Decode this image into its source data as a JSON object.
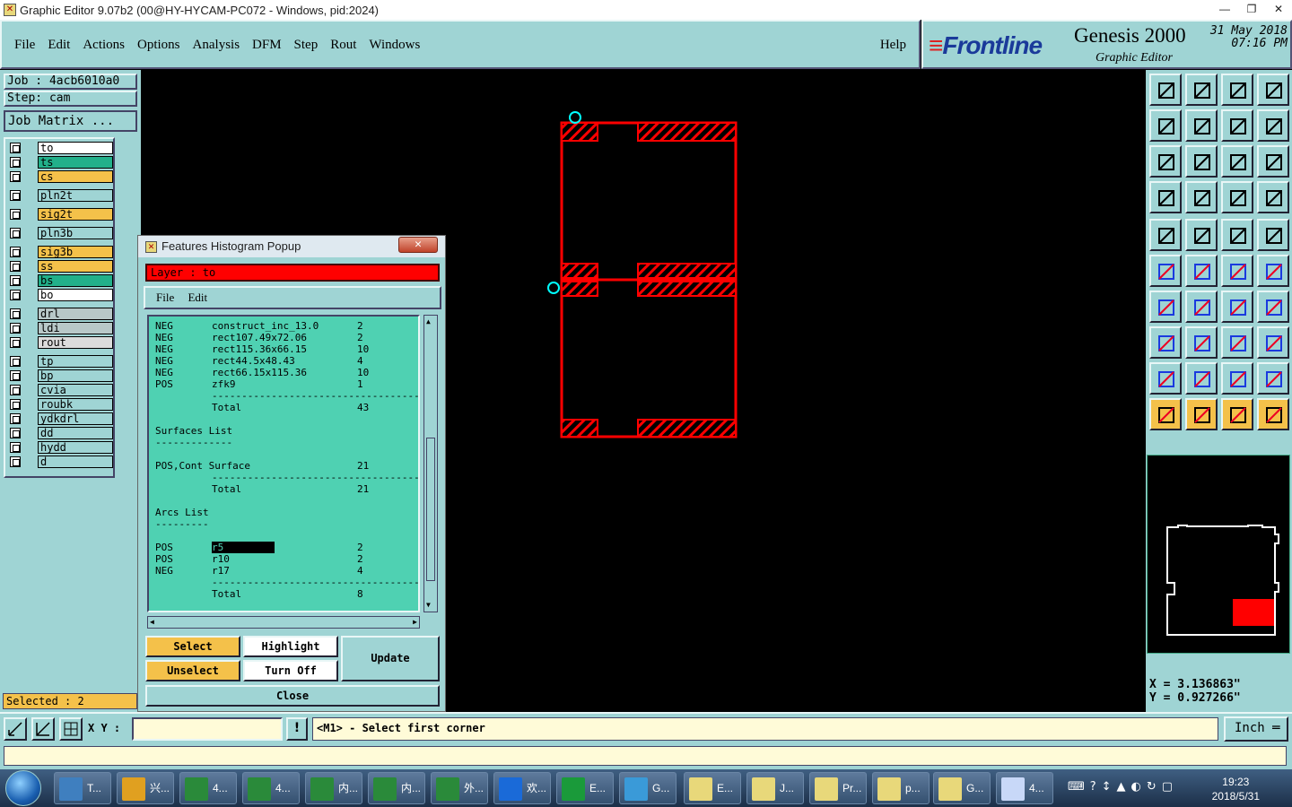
{
  "window": {
    "title": "Graphic Editor 9.07b2 (00@HY-HYCAM-PC072 - Windows, pid:2024)",
    "controls": [
      "—",
      "❐",
      "✕"
    ]
  },
  "menu": {
    "items": [
      "File",
      "Edit",
      "Actions",
      "Options",
      "Analysis",
      "DFM",
      "Step",
      "Rout",
      "Windows"
    ],
    "help": "Help"
  },
  "brand": {
    "logo": "Frontline",
    "product": "Genesis 2000",
    "subtitle": "Graphic Editor",
    "date": "31 May 2018",
    "time": "07:16 PM"
  },
  "job": {
    "job_label": "Job : 4acb6010a0",
    "step_label": "Step: cam",
    "matrix_button": "Job Matrix ..."
  },
  "layers": [
    {
      "name": "to",
      "color": "#ffffff"
    },
    {
      "name": "ts",
      "color": "#22b08a"
    },
    {
      "name": "cs",
      "color": "#f4c14a"
    },
    {
      "name": "pln2t",
      "color": "#9fd4d4"
    },
    {
      "name": "sig2t",
      "color": "#f4c14a"
    },
    {
      "name": "pln3b",
      "color": "#9fd4d4"
    },
    {
      "name": "sig3b",
      "color": "#f4c14a"
    },
    {
      "name": "ss",
      "color": "#f4c14a"
    },
    {
      "name": "bs",
      "color": "#22b08a"
    },
    {
      "name": "bo",
      "color": "#ffffff"
    },
    {
      "name": "drl",
      "color": "#b8c8c8"
    },
    {
      "name": "ldi",
      "color": "#b8c8c8"
    },
    {
      "name": "rout",
      "color": "#dcdcdc"
    },
    {
      "name": "tp",
      "color": "#9fd4d4"
    },
    {
      "name": "bp",
      "color": "#9fd4d4"
    },
    {
      "name": "cvia",
      "color": "#9fd4d4"
    },
    {
      "name": "roubk",
      "color": "#9fd4d4"
    },
    {
      "name": "ydkdrl",
      "color": "#9fd4d4"
    },
    {
      "name": "dd",
      "color": "#9fd4d4"
    },
    {
      "name": "hydd",
      "color": "#9fd4d4"
    },
    {
      "name": "d",
      "color": "#9fd4d4"
    }
  ],
  "status": {
    "selected": "Selected : 2"
  },
  "popup": {
    "title": "Features Histogram Popup",
    "close_x": "✕",
    "layer_label": "Layer : to",
    "menu": [
      "File",
      "Edit"
    ],
    "lines": [
      [
        "NEG",
        "construct_inc_13.0",
        "2"
      ],
      [
        "NEG",
        "rect107.49x72.06",
        "2"
      ],
      [
        "NEG",
        "rect115.36x66.15",
        "10"
      ],
      [
        "NEG",
        "rect44.5x48.43",
        "4"
      ],
      [
        "NEG",
        "rect66.15x115.36",
        "10"
      ],
      [
        "POS",
        "zfk9",
        "1"
      ],
      [
        "",
        "----------------------------------------------",
        ""
      ],
      [
        "",
        "Total",
        "43"
      ],
      [
        "",
        "",
        ""
      ],
      [
        "Surfaces List",
        "",
        ""
      ],
      [
        "-------------",
        "",
        ""
      ],
      [
        "",
        "",
        ""
      ],
      [
        "POS,Cont Surface",
        "",
        "21"
      ],
      [
        "",
        "----------------------------------------------",
        ""
      ],
      [
        "",
        "Total",
        "21"
      ],
      [
        "",
        "",
        ""
      ],
      [
        "Arcs List",
        "",
        ""
      ],
      [
        "---------",
        "",
        ""
      ],
      [
        "",
        "",
        ""
      ],
      [
        "POS",
        "r5",
        "2"
      ],
      [
        "POS",
        "r10",
        "2"
      ],
      [
        "NEG",
        "r17",
        "4"
      ],
      [
        "",
        "----------------------------------------------",
        ""
      ],
      [
        "",
        "Total",
        "8"
      ]
    ],
    "buttons": {
      "select": "Select",
      "highlight": "Highlight",
      "update": "Update",
      "unselect": "Unselect",
      "turn_off": "Turn Off",
      "close": "Close"
    }
  },
  "coords": {
    "x": "X = 3.136863\"",
    "y": "Y = 0.927266\""
  },
  "command": {
    "xy_label": "X Y :",
    "prompt": "<M1> - Select first corner",
    "units": "Inch ═"
  },
  "taskbar": {
    "buttons": [
      "T...",
      "兴...",
      "4...",
      "4...",
      "内...",
      "内...",
      "外...",
      "欢...",
      "E...",
      "G...",
      "E...",
      "J...",
      "Pr...",
      "p...",
      "G...",
      "4..."
    ],
    "time": "19:23",
    "date": "2018/5/31"
  }
}
